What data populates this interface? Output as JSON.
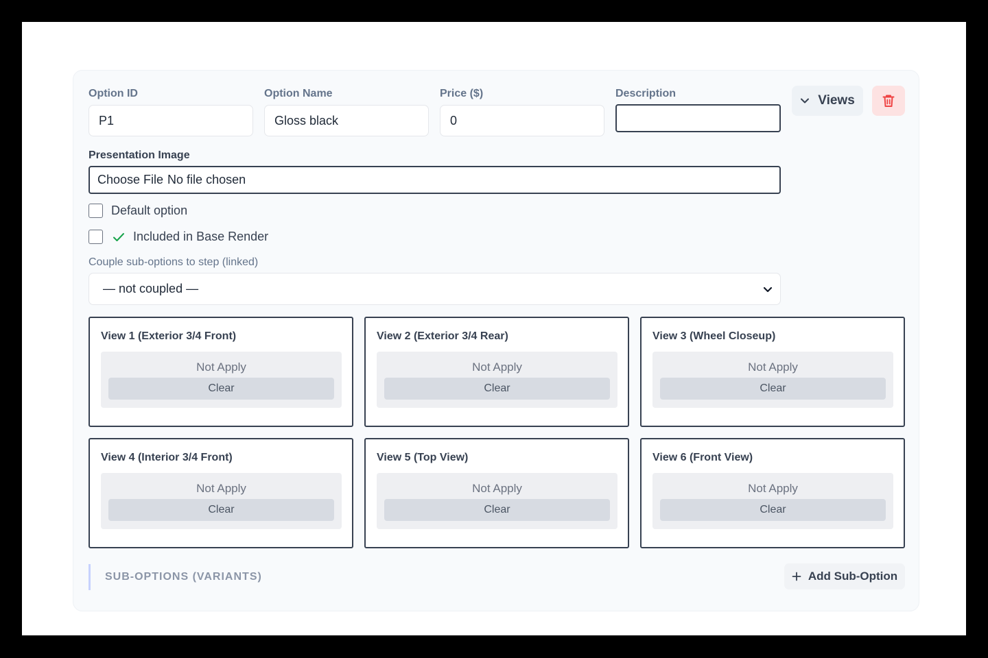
{
  "fields": {
    "option_id": {
      "label": "Option ID",
      "value": "P1"
    },
    "option_name": {
      "label": "Option Name",
      "value": "Gloss black"
    },
    "price": {
      "label": "Price ($)",
      "value": "0"
    },
    "description": {
      "label": "Description",
      "value": ""
    }
  },
  "header_buttons": {
    "views_label": "Views"
  },
  "presentation_image": {
    "label": "Presentation Image",
    "button": "Choose File",
    "status": "No file chosen"
  },
  "checkboxes": {
    "default_option": "Default option",
    "included_base_render": "Included in Base Render"
  },
  "couple": {
    "label": "Couple sub-options to step (linked)",
    "selected": "— not coupled —"
  },
  "views": [
    {
      "title": "View 1 (Exterior 3/4 Front)",
      "status": "Not Apply",
      "clear": "Clear"
    },
    {
      "title": "View 2 (Exterior 3/4 Rear)",
      "status": "Not Apply",
      "clear": "Clear"
    },
    {
      "title": "View 3 (Wheel Closeup)",
      "status": "Not Apply",
      "clear": "Clear"
    },
    {
      "title": "View 4 (Interior 3/4 Front)",
      "status": "Not Apply",
      "clear": "Clear"
    },
    {
      "title": "View 5 (Top View)",
      "status": "Not Apply",
      "clear": "Clear"
    },
    {
      "title": "View 6 (Front View)",
      "status": "Not Apply",
      "clear": "Clear"
    }
  ],
  "sub_options": {
    "heading": "SUB-OPTIONS (VARIANTS)",
    "add_label": "Add Sub-Option"
  },
  "colors": {
    "accent_check": "#16a34a",
    "danger": "#ef4444",
    "danger_bg": "#fde2e2"
  }
}
